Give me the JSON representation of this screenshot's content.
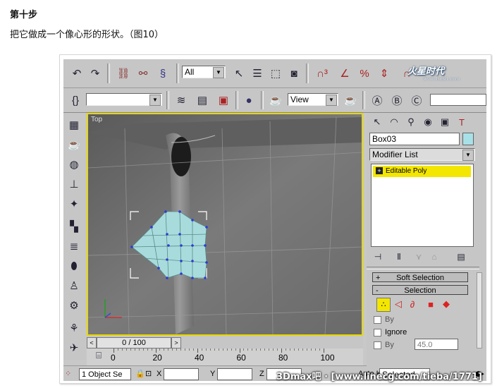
{
  "article": {
    "heading": "第十步",
    "description": "把它做成一个像心形的形状。（图10）"
  },
  "toolbar_main": {
    "selection_filter": "All",
    "reference_coord": "View"
  },
  "command_panel": {
    "object_name": "Box03",
    "object_color": "#a8e0e8",
    "modifier_list_label": "Modifier List",
    "stack_item": "Editable Poly",
    "rollouts": {
      "soft_selection": "Soft Selection",
      "selection": "Selection"
    },
    "options": {
      "by_vertex": "By",
      "ignore_backfacing": "Ignore",
      "by_angle": "By",
      "angle_value": "45.0"
    }
  },
  "viewport": {
    "label": "Top",
    "accent_color": "#e8d800",
    "heart_color": "#a8dcdc"
  },
  "timeline": {
    "frame_readout": "0 / 100",
    "ticks": [
      "0",
      "20",
      "40",
      "60",
      "80",
      "100"
    ]
  },
  "status_bar": {
    "selection_info": "1 Object Se",
    "x_label": "X",
    "y_label": "Y",
    "z_label": "Z",
    "auto_key_label": "Auto Key",
    "key_mode_value": "Selected"
  },
  "watermarks": {
    "tieba": "3Dmax吧 · [www.linecg.com/tieba/1771]",
    "logo": "火星时代",
    "logo_sub": "www.hxsd.com"
  }
}
